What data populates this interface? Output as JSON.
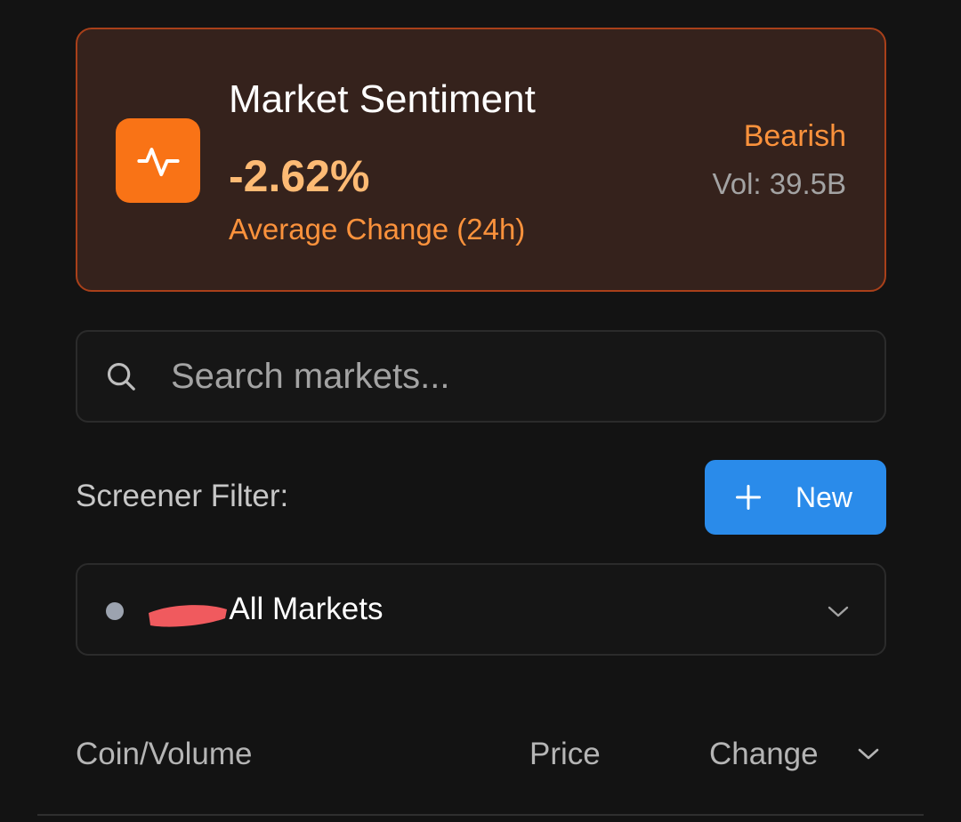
{
  "sentiment": {
    "title": "Market Sentiment",
    "value": "-2.62%",
    "subtitle": "Average Change (24h)",
    "label": "Bearish",
    "volume": "Vol: 39.5B",
    "icon": "activity-pulse-icon",
    "accent_color": "#f97316"
  },
  "search": {
    "placeholder": "Search markets...",
    "value": "",
    "icon": "search-icon"
  },
  "screener": {
    "label": "Screener Filter:",
    "new_button_label": "New",
    "new_button_color": "#2a8bea",
    "selected_option": "Show All Markets",
    "visible_text": "All Markets"
  },
  "table_header": {
    "columns": [
      "Coin/Volume",
      "Price",
      "Change"
    ]
  }
}
